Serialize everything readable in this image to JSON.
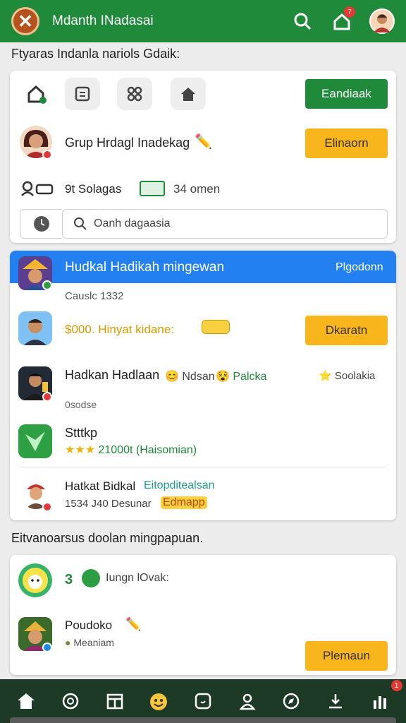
{
  "header": {
    "title": "Mdanth INadasai",
    "notification_count": "7",
    "icons": [
      "close-icon",
      "search-icon",
      "home-notification-icon",
      "profile-avatar"
    ]
  },
  "section1": {
    "title": "Ftyaras Indanla nariols Gdaik:"
  },
  "quick_actions": {
    "primary_button": "Eandiaak",
    "tiles": [
      "home-add-icon",
      "document-icon",
      "apps-icon",
      "house-icon"
    ]
  },
  "group": {
    "name": "Grup Hrdagl Inadekag",
    "button": "Elinaorn",
    "stats": {
      "label_a": "9t Solagas",
      "label_b": "34 omen"
    }
  },
  "search": {
    "placeholder": "Oanh dagaasia"
  },
  "feed": {
    "banner_title": "Hudkal Hadikah mingewan",
    "banner_action": "Plgodonn",
    "subtitle": "Causlc 1332",
    "item1": {
      "text": "$000. Hinyat kidane:",
      "button": "Dkaratn"
    },
    "item2": {
      "name": "Hadkan Hadlaan",
      "tag1": "Ndsan",
      "tag2": "Palcka",
      "tag3": "Soolakia",
      "meta": "0sodse"
    },
    "item3": {
      "name": "Stttkp",
      "rating_text": "21000t (Haisomian)"
    },
    "item4": {
      "name": "Hatkat Bidkal",
      "link": "Eitopditealsan",
      "meta": "1534 J40 Desunar",
      "tag": "Edmapp"
    }
  },
  "section2": {
    "title": "Eitvanoarsus doolan mingpapuan."
  },
  "list2": {
    "item1": {
      "text": "Iungn lOvak:",
      "num": "3"
    },
    "item2": {
      "name": "Poudoko",
      "meta": "Meaniam",
      "button": "Plemaun"
    }
  },
  "colors": {
    "brand_green": "#1e8a3a",
    "accent_yellow": "#f8b51c",
    "banner_blue": "#2380f0",
    "nav_dark": "#1d3a26"
  },
  "bottom_nav": {
    "badge": "1",
    "items": [
      "home-icon",
      "chat-icon",
      "calendar-icon",
      "emoji-icon",
      "message-icon",
      "profile-icon",
      "compass-icon",
      "download-icon",
      "stats-icon"
    ]
  }
}
